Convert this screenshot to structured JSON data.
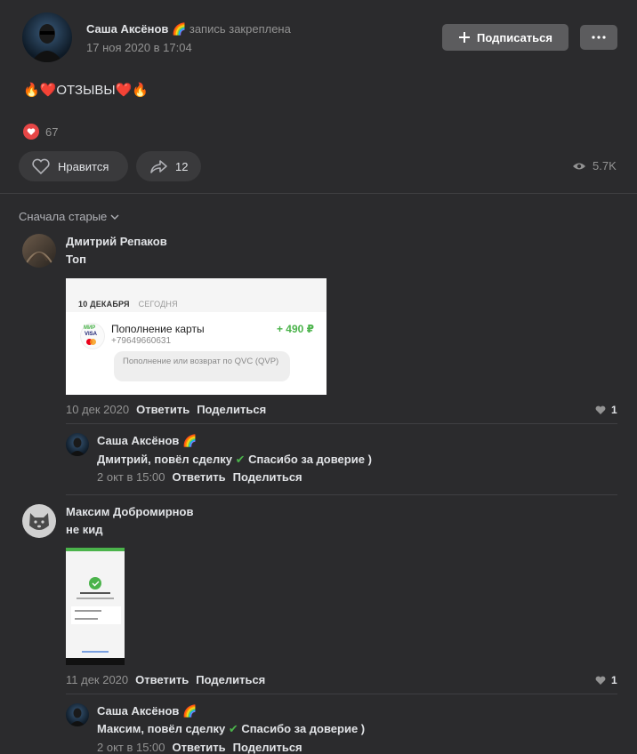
{
  "post": {
    "author": "Саша Аксёнов",
    "author_emoji": "🌈",
    "pinned_text": "запись закреплена",
    "date": "17 ноя 2020 в 17:04",
    "subscribe_label": "Подписаться",
    "text": "🔥❤️ОТЗЫВЫ❤️🔥",
    "reactions_count": "67",
    "like_label": "Нравится",
    "share_count": "12",
    "views": "5.7K"
  },
  "sort_label": "Сначала старые",
  "comments": [
    {
      "author": "Дмитрий Репаков",
      "text": "Топ",
      "date": "10 дек 2020",
      "reply": "Ответить",
      "share": "Поделиться",
      "likes": "1",
      "attachment": {
        "date_header": "10 ДЕКАБРЯ",
        "today": "СЕГОДНЯ",
        "title": "Пополнение карты",
        "phone": "+79649660631",
        "amount": "+ 490 ₽",
        "note": "Пополнение или возврат по QVC (QVP)",
        "mir": "МИР",
        "visa": "VISA"
      },
      "answer": {
        "author": "Саша Аксёнов",
        "author_emoji": "🌈",
        "text_before": "Дмитрий, повёл сделку",
        "check": "✔",
        "text_after": "Спасибо за доверие )",
        "date": "2 окт в 15:00",
        "reply": "Ответить",
        "share": "Поделиться"
      }
    },
    {
      "author": "Максим Добромирнов",
      "text": "не кид",
      "date": "11 дек 2020",
      "reply": "Ответить",
      "share": "Поделиться",
      "likes": "1",
      "answer": {
        "author": "Саша Аксёнов",
        "author_emoji": "🌈",
        "text_before": "Максим, повёл сделку",
        "check": "✔",
        "text_after": "Спасибо за доверие )",
        "date": "2 окт в 15:00",
        "reply": "Ответить",
        "share": "Поделиться"
      }
    }
  ],
  "colors": {
    "background": "#2b2b2d",
    "button": "#5c5c5e",
    "pill": "#3a3a3c",
    "heart": "#e64646",
    "check": "#4bb34b"
  }
}
